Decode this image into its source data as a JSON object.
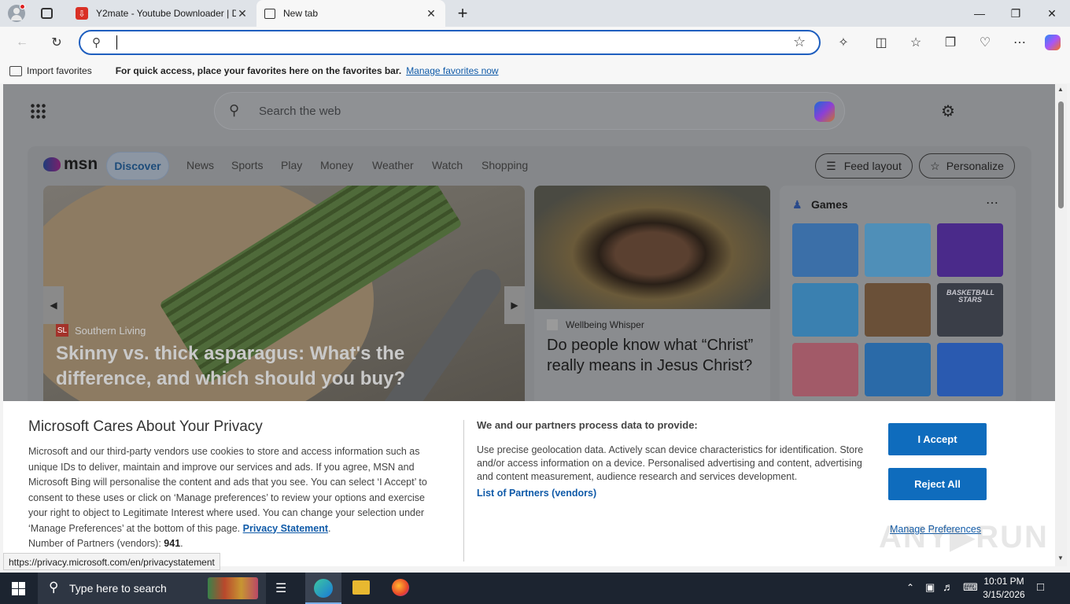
{
  "browser": {
    "tabs": [
      {
        "title": "Y2mate - Youtube Downloader | D",
        "active": false
      },
      {
        "title": "New tab",
        "active": true
      }
    ],
    "new_tab_symbol": "+",
    "window_controls": [
      "minimize-icon",
      "restore-icon",
      "close-icon"
    ],
    "address": {
      "value": "",
      "placeholder": ""
    },
    "favorites_bar": {
      "import_label": "Import favorites",
      "message": "For quick access, place your favorites here on the favorites bar.",
      "manage_link": "Manage favorites now"
    }
  },
  "msn": {
    "search_placeholder": "Search the web",
    "logo_text": "msn",
    "nav": [
      "Discover",
      "News",
      "Sports",
      "Play",
      "Money",
      "Weather",
      "Watch",
      "Shopping"
    ],
    "active_nav": "Discover",
    "feed_layout_label": "Feed layout",
    "personalize_label": "Personalize",
    "hero": {
      "source": "Southern Living",
      "title": "Skinny vs. thick asparagus: What's the difference, and which should you buy?"
    },
    "card2": {
      "source": "Wellbeing Whisper",
      "title": "Do people know what “Christ” really means in Jesus Christ?"
    },
    "games": {
      "title": "Games",
      "tile_colors": [
        "#3b7fd6",
        "#5db3e8",
        "#6a2fd0",
        "#3aa0e0",
        "#7a5a3c",
        "#3b3f47",
        "#e65a6a",
        "#1a7fd8",
        "#1f5fd8"
      ],
      "basketball_label": "BASKETBALL STARS"
    }
  },
  "consent": {
    "title": "Microsoft Cares About Your Privacy",
    "body": "Microsoft and our third-party vendors use cookies to store and access information such as unique IDs to deliver, maintain and improve our services and ads. If you agree, MSN and Microsoft Bing will personalise the content and ads that you see. You can select ‘I Accept’ to consent to these uses or click on ‘Manage preferences’ to review your options and exercise your right to object to Legitimate Interest where used.  You can change your selection under ‘Manage Preferences’ at the bottom of this page.",
    "privacy_link": "Privacy Statement",
    "partners_label": "Number of Partners (vendors):",
    "partners_count": "941",
    "process_title": "We and our partners process data to provide:",
    "process_body": "Use precise geolocation data. Actively scan device characteristics for identification. Store and/or access information on a device. Personalised advertising and content, advertising and content measurement, audience research and services development.",
    "partners_link": "List of Partners (vendors)",
    "accept_label": "I Accept",
    "reject_label": "Reject All",
    "manage_label": "Manage Preferences"
  },
  "status_url": "https://privacy.microsoft.com/en/privacystatement",
  "taskbar": {
    "search_placeholder": "Type here to search",
    "time": "10:01 PM",
    "date": "3/15/2026"
  },
  "colors": {
    "accent": "#0f6cbd",
    "taskbar": "#1c2430"
  }
}
